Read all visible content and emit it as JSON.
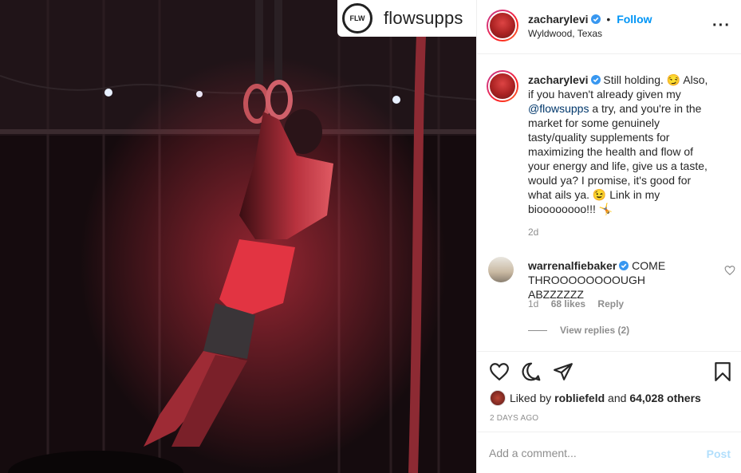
{
  "photo": {
    "brand_name": "flowsupps",
    "brand_logo_text": "FLW"
  },
  "post": {
    "username": "zacharylevi",
    "follow_label": "Follow",
    "dot": "•",
    "location": "Wyldwood, Texas",
    "more_label": "•••"
  },
  "caption": {
    "username": "zacharylevi",
    "text_part1": " Still holding. 😏 Also, if you haven't already given my ",
    "mention": "@flowsupps",
    "text_part2": " a try, and you're in the market for some genuinely tasty/quality supplements for maximizing the health and flow of your energy and life, give us a taste, would ya? I promise, it's good for what ails ya. 😉 Link in my bioooooooo!!! 🤸",
    "time": "2d"
  },
  "comment": {
    "username": "warrenalfiebaker",
    "text": " COME THROOOOOOOOUGH ABZZZZZZ",
    "time": "1d",
    "likes": "68 likes",
    "reply_label": "Reply",
    "view_replies": "View replies (2)"
  },
  "likes": {
    "prefix": "Liked by ",
    "user": "robliefeld",
    "connector": " and ",
    "others": "64,028 others"
  },
  "timestamp": "2 DAYS AGO",
  "add_comment": {
    "placeholder": "Add a comment...",
    "post_label": "Post"
  },
  "colors": {
    "link_blue": "#0095f6",
    "mention_blue": "#00376b",
    "post_disabled": "#b2dffc",
    "muted": "#8e8e8e"
  }
}
